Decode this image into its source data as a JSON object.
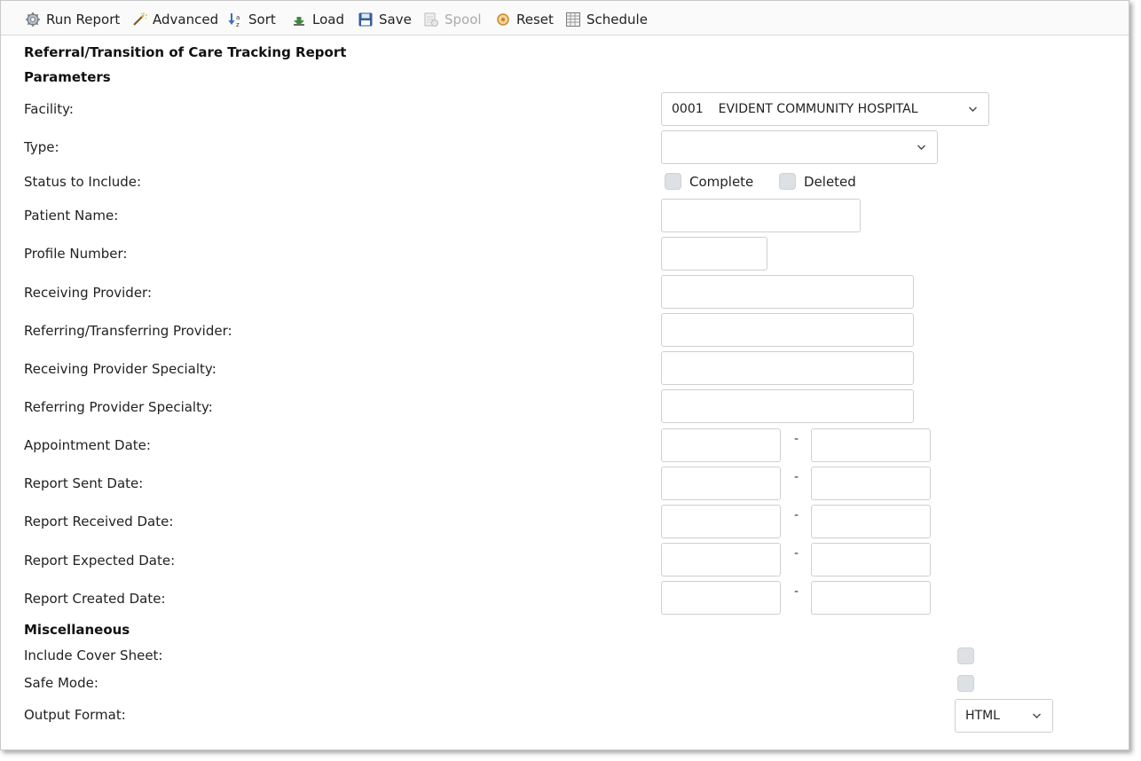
{
  "toolbar": {
    "run_report": "Run Report",
    "advanced": "Advanced",
    "sort": "Sort",
    "load": "Load",
    "save": "Save",
    "spool": "Spool",
    "reset": "Reset",
    "schedule": "Schedule"
  },
  "report_title": "Referral/Transition of Care Tracking Report",
  "parameters": {
    "heading": "Parameters",
    "facility": {
      "label": "Facility:",
      "code": "0001",
      "name": "EVIDENT COMMUNITY HOSPITAL"
    },
    "type": {
      "label": "Type:",
      "value": ""
    },
    "status": {
      "label": "Status to Include:",
      "complete": "Complete",
      "deleted": "Deleted"
    },
    "patient_name": {
      "label": "Patient Name:",
      "value": ""
    },
    "profile_number": {
      "label": "Profile Number:",
      "value": ""
    },
    "receiving_provider": {
      "label": "Receiving Provider:",
      "value": ""
    },
    "referring_provider": {
      "label": "Referring/Transferring Provider:",
      "value": ""
    },
    "receiving_specialty": {
      "label": "Receiving Provider Specialty:",
      "value": ""
    },
    "referring_specialty": {
      "label": "Referring Provider Specialty:",
      "value": ""
    },
    "appointment_date": {
      "label": "Appointment Date:"
    },
    "report_sent_date": {
      "label": "Report Sent Date:"
    },
    "report_received_date": {
      "label": "Report Received Date:"
    },
    "report_expected_date": {
      "label": "Report Expected Date:"
    },
    "report_created_date": {
      "label": "Report Created Date:"
    },
    "range_separator": "-"
  },
  "misc": {
    "heading": "Miscellaneous",
    "cover_sheet": "Include Cover Sheet:",
    "safe_mode": "Safe Mode:",
    "output_format": {
      "label": "Output Format:",
      "value": "HTML"
    }
  }
}
